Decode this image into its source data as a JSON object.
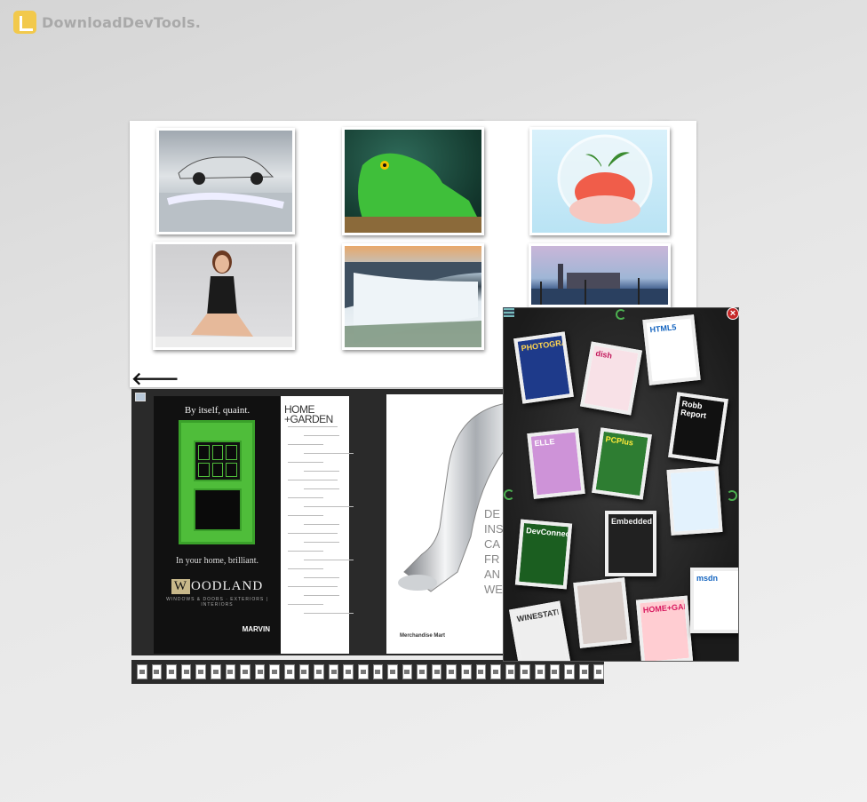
{
  "watermark": {
    "text": "DownloadDevTools."
  },
  "photo_page": {
    "photos": [
      {
        "subject": "car"
      },
      {
        "subject": "lizard"
      },
      {
        "subject": "dessert"
      },
      {
        "subject": "woman"
      },
      {
        "subject": "waterfall"
      },
      {
        "subject": "venice"
      }
    ]
  },
  "nav": {
    "back_arrow": "🡐"
  },
  "magazine": {
    "ad_headline": "By itself, quaint.",
    "ad_subline": "In your home, brilliant.",
    "ad_brand_initial": "W",
    "ad_brand_rest": "OODLAND",
    "ad_brand_tag": "WINDOWS & DOORS · EXTERIORS | INTERIORS",
    "ad_marvin": "MARVIN",
    "toc_title_line1": "HOME",
    "toc_title_line2": "+GARDEN",
    "faucet_big_text": [
      "DE",
      "INS",
      "CA",
      "FR",
      "AN",
      "WELC"
    ],
    "faucet_store": "Merchandise Mart"
  },
  "thumbnail_strip": {
    "count": 32
  },
  "bookshelf": {
    "close_label": "×",
    "magazines": [
      {
        "title": "PHOTOGRAPHY",
        "bg": "#1e3a8a",
        "fg": "#ffd54f"
      },
      {
        "title": "dish",
        "bg": "#f8e1e7",
        "fg": "#c2185b"
      },
      {
        "title": "HTML5",
        "bg": "#ffffff",
        "fg": "#1565c0"
      },
      {
        "title": "Robb Report",
        "bg": "#111111",
        "fg": "#ffffff"
      },
      {
        "title": "ELLE",
        "bg": "#ce93d8",
        "fg": "#ffffff"
      },
      {
        "title": "PCPlus",
        "bg": "#2e7d32",
        "fg": "#ffeb3b"
      },
      {
        "title": "",
        "bg": "#e3f2fd",
        "fg": "#d32f2f"
      },
      {
        "title": "DevConnections",
        "bg": "#1b5e20",
        "fg": "#ffffff"
      },
      {
        "title": "Embedded",
        "bg": "#212121",
        "fg": "#eeeeee"
      },
      {
        "title": "",
        "bg": "#d7ccc8",
        "fg": "#5d4037"
      },
      {
        "title": "WINESTATE",
        "bg": "#eeeeee",
        "fg": "#333333"
      },
      {
        "title": "HOME+GARDEN",
        "bg": "#ffcdd2",
        "fg": "#d81b60"
      },
      {
        "title": "msdn",
        "bg": "#ffffff",
        "fg": "#1565c0"
      }
    ]
  }
}
